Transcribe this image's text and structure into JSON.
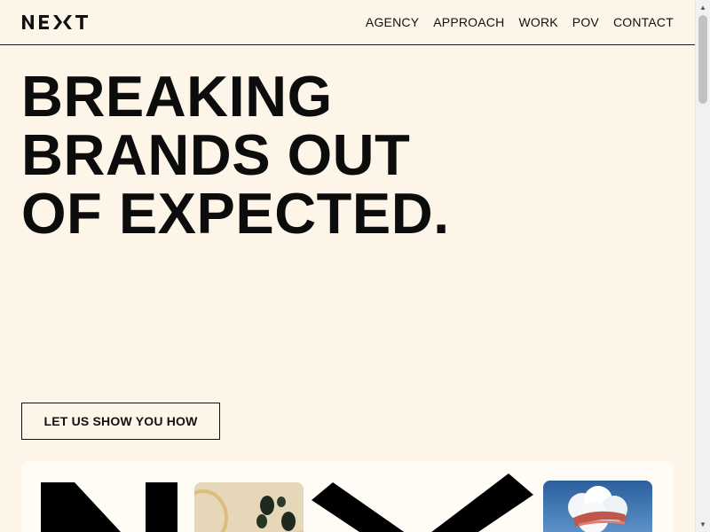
{
  "header": {
    "logo_text": "NEXT",
    "nav": [
      {
        "label": "AGENCY"
      },
      {
        "label": "APPROACH"
      },
      {
        "label": "WORK"
      },
      {
        "label": "POV"
      },
      {
        "label": "CONTACT"
      }
    ]
  },
  "hero": {
    "lines": [
      "BREAKING",
      "BRANDS OUT",
      "OF EXPECTED."
    ],
    "cta_label": "LET US SHOW YOU HOW"
  },
  "showcase": {
    "cards": [
      {
        "icon": "food-photo"
      },
      {
        "icon": "sky-cloud-photo"
      }
    ]
  },
  "colors": {
    "background": "#fdf5e8",
    "text": "#111111",
    "panel": "#fffcf6"
  }
}
